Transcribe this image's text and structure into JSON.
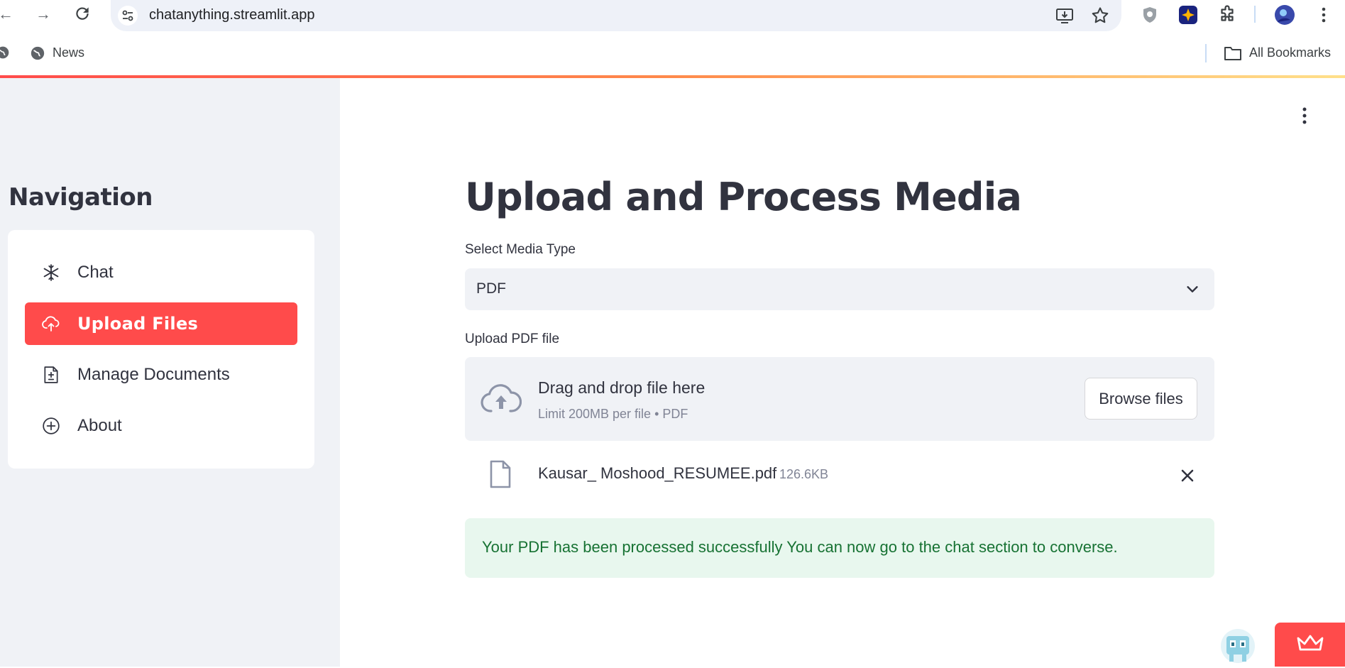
{
  "browser": {
    "url": "chatanything.streamlit.app",
    "bookmarks": {
      "news_label": "News",
      "all_bookmarks_label": "All Bookmarks"
    }
  },
  "sidebar": {
    "title": "Navigation",
    "items": [
      {
        "label": "Chat",
        "icon": "snowflake-icon"
      },
      {
        "label": "Upload Files",
        "icon": "cloud-upload-icon",
        "active": true
      },
      {
        "label": "Manage Documents",
        "icon": "document-icon"
      },
      {
        "label": "About",
        "icon": "plus-circle-icon"
      }
    ],
    "active_color": "#ff4b4b"
  },
  "main": {
    "title": "Upload and Process Media",
    "media_type": {
      "label": "Select Media Type",
      "selected": "PDF"
    },
    "uploader": {
      "label": "Upload PDF file",
      "drop_title": "Drag and drop file here",
      "drop_subtitle": "Limit 200MB per file • PDF",
      "browse_label": "Browse files"
    },
    "file": {
      "name": "Kausar_ Moshood_RESUMEE.pdf",
      "size": "126.6KB"
    },
    "success_message": "Your PDF has been processed successfully You can now go to the chat section to converse."
  },
  "colors": {
    "accent": "#ff4b4b",
    "success_bg": "#e8f7ee",
    "success_text": "#177233"
  }
}
